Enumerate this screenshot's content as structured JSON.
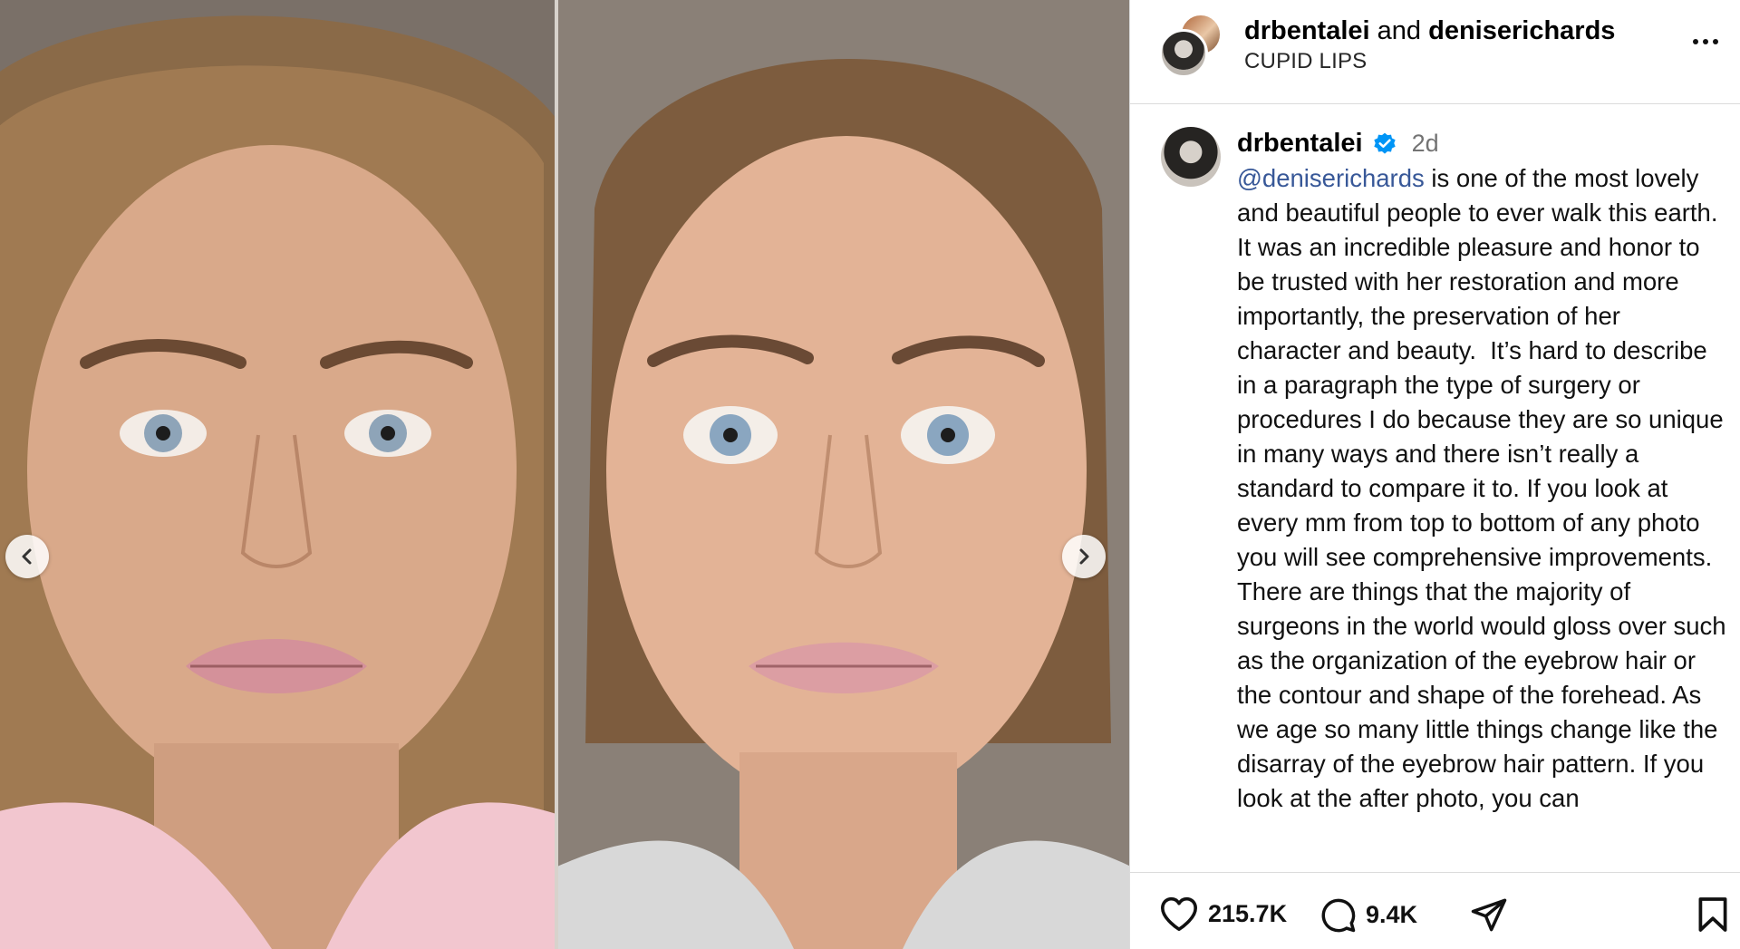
{
  "header": {
    "user1": "drbentalei",
    "conjunction": "and",
    "user2": "deniserichards",
    "subtitle": "CUPID LIPS"
  },
  "caption": {
    "username": "drbentalei",
    "time": "2d",
    "mention": "@deniserichards",
    "text": " is one of the most lovely and beautiful people to ever walk this earth. It was an incredible pleasure and honor to be trusted with her restoration and more importantly, the preservation of her character and beauty.  It’s hard to describe in a paragraph the type of surgery or procedures I do because they are so unique in many ways and there isn’t really a standard to compare it to. If you look at every mm from top to bottom of any photo you will see comprehensive improvements.  There are things that the majority of surgeons in the world would gloss over such as the organization of the eyebrow hair or the contour and shape of the forehead. As we age so many little things change like the disarray of the eyebrow hair pattern. If you look at the after photo, you can"
  },
  "actions": {
    "likes": "215.7K",
    "comments": "9.4K"
  },
  "icons": {
    "prev": "chevron-left-icon",
    "next": "chevron-right-icon",
    "verified": "verified-badge-icon",
    "like": "heart-icon",
    "comment": "comment-icon",
    "share": "share-icon",
    "save": "bookmark-icon",
    "more": "more-options-icon"
  },
  "colors": {
    "verified": "#0095f6",
    "mention": "#385898",
    "secondary_text": "#737373"
  }
}
